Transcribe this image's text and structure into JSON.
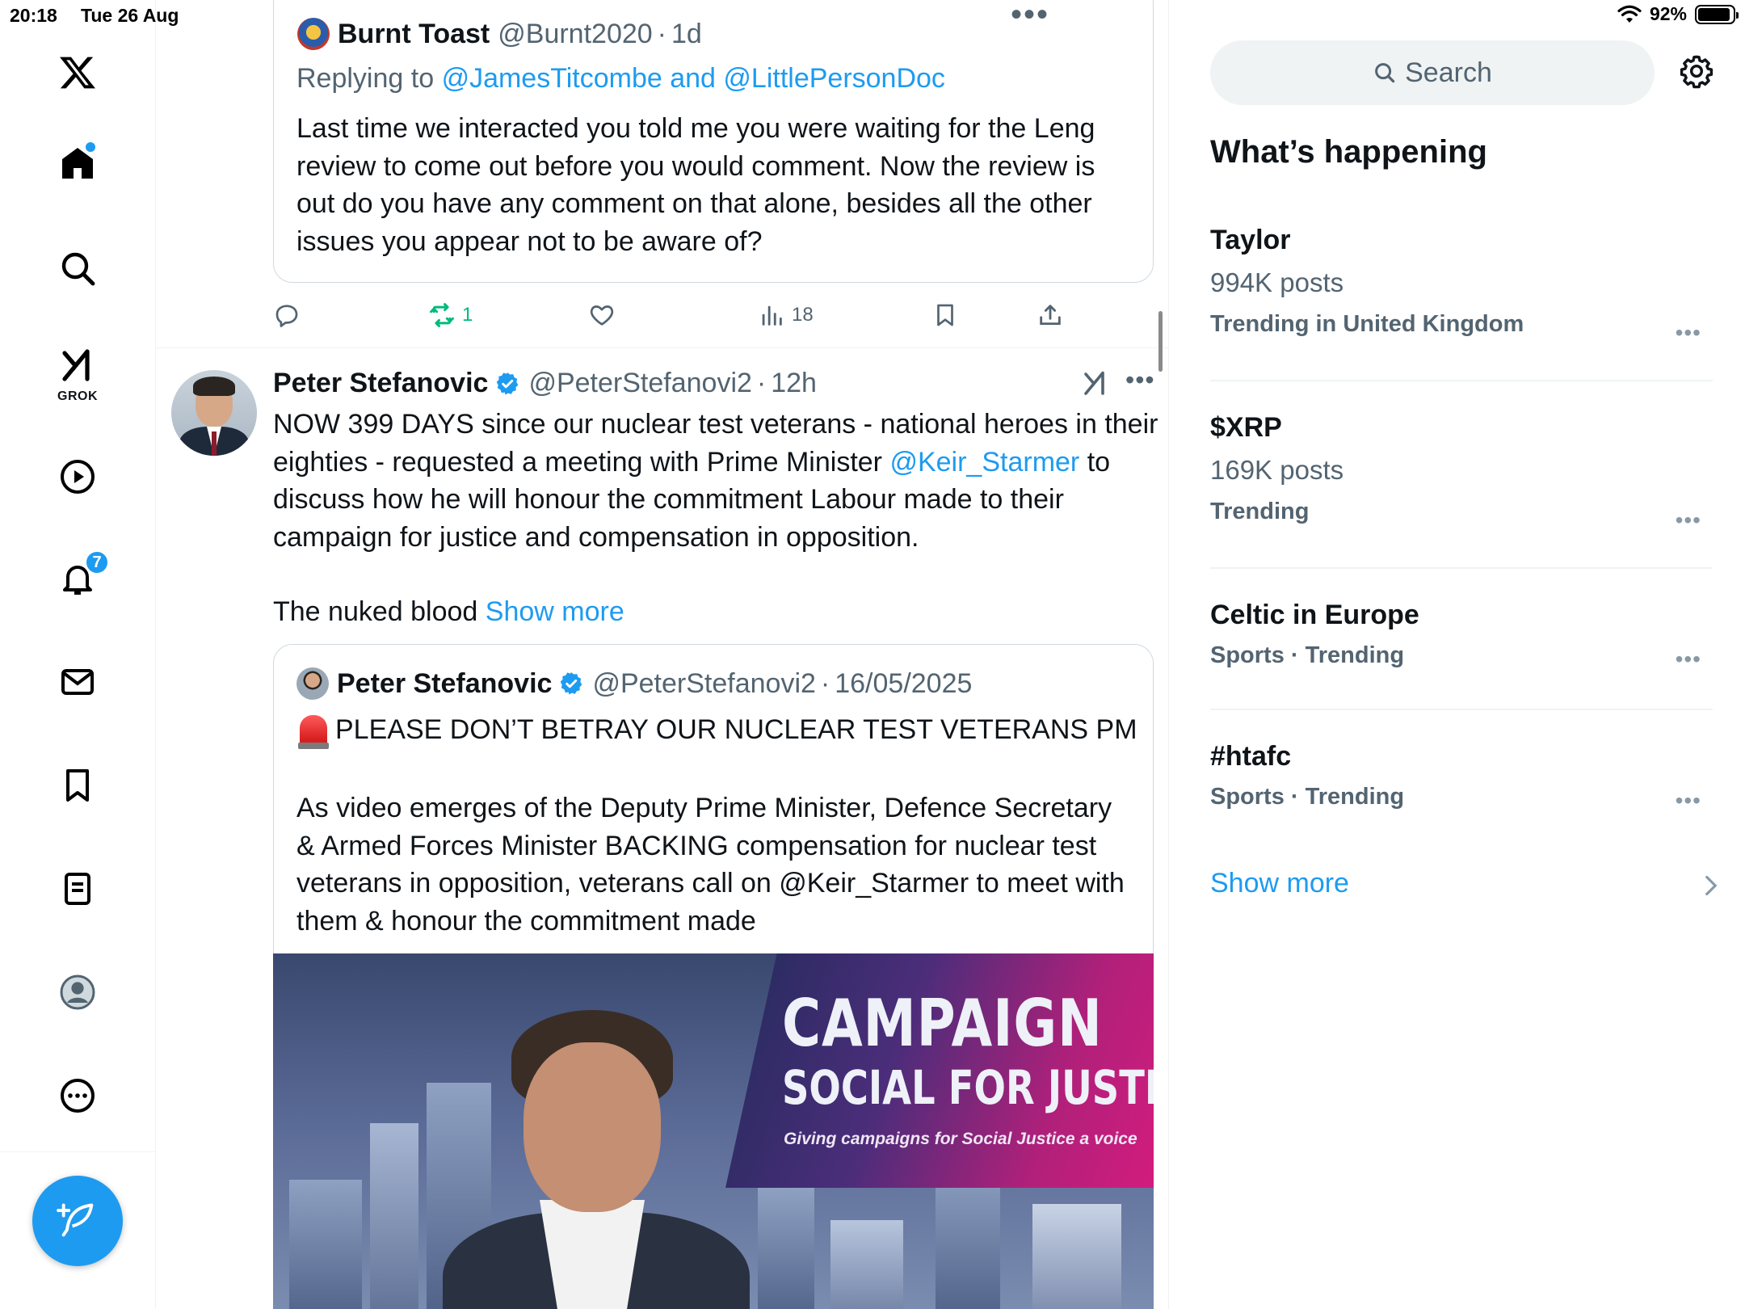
{
  "status_bar": {
    "time": "20:18",
    "date": "Tue 26 Aug",
    "battery_text": "92%",
    "battery_level": 0.92
  },
  "nav": {
    "grok_label": "GROK",
    "notification_count": "7",
    "items": [
      "x-logo",
      "home-icon",
      "search-icon",
      "grok-icon",
      "video-icon",
      "bell-icon",
      "mail-icon",
      "bookmark-icon",
      "lists-icon",
      "profile-icon",
      "more-icon"
    ]
  },
  "top_tweet": {
    "name": "Burnt Toast",
    "handle": "@Burnt2020",
    "sep": "·",
    "time": "1d",
    "replying_prefix": "Replying to",
    "replying_to": "@JamesTitcombe and @LittlePersonDoc",
    "text": "Last time we interacted you told me you were waiting for the Leng review to come out before you would comment. Now the review is out do you have any comment on that alone, besides all the other issues you appear not to be aware of?",
    "actions": {
      "retweets": "1",
      "views": "18"
    },
    "more": "•••"
  },
  "tweet": {
    "name": "Peter Stefanovic",
    "handle": "@PeterStefanovi2",
    "sep": "·",
    "time": "12h",
    "more": "•••",
    "text_before_mention": "NOW 399 DAYS since our nuclear test veterans - national heroes in their eighties - requested a meeting with Prime Minister ",
    "mention": "@Keir_Starmer",
    "text_after_mention": " to discuss how he will honour the commitment Labour made to their campaign for justice and compensation in opposition.",
    "text_line2": "The nuked blood ",
    "show_more": "Show more",
    "quote": {
      "name": "Peter Stefanovic",
      "handle": "@PeterStefanovi2",
      "sep": "·",
      "date": "16/05/2025",
      "line1": "PLEASE DON’T BETRAY OUR NUCLEAR TEST VETERANS PM",
      "text": "As video emerges of the Deputy Prime Minister, Defence Secretary & Armed Forces Minister BACKING compensation for nuclear test veterans in opposition, veterans call on @Keir_Starmer to meet with them & honour the commitment made",
      "media": {
        "banner_line1": "CAMPAIGN",
        "banner_line2": "SOCIAL FOR JUSTICE",
        "banner_line3": "Giving campaigns for Social Justice a voice"
      }
    }
  },
  "right": {
    "search_placeholder": "Search",
    "title": "What’s happening",
    "trends": [
      {
        "name": "Taylor",
        "posts": "994K posts",
        "context": "Trending in United Kingdom"
      },
      {
        "name": "$XRP",
        "posts": "169K posts",
        "context": "Trending"
      },
      {
        "name": "Celtic in Europe",
        "context": "Sports · Trending"
      },
      {
        "name": "#htafc",
        "context": "Sports · Trending"
      }
    ],
    "trend_more": "•••",
    "show_more": "Show more"
  },
  "colors": {
    "accent": "#1d9bf0",
    "retweet_green": "#00ba7c",
    "secondary_text": "#536471"
  }
}
